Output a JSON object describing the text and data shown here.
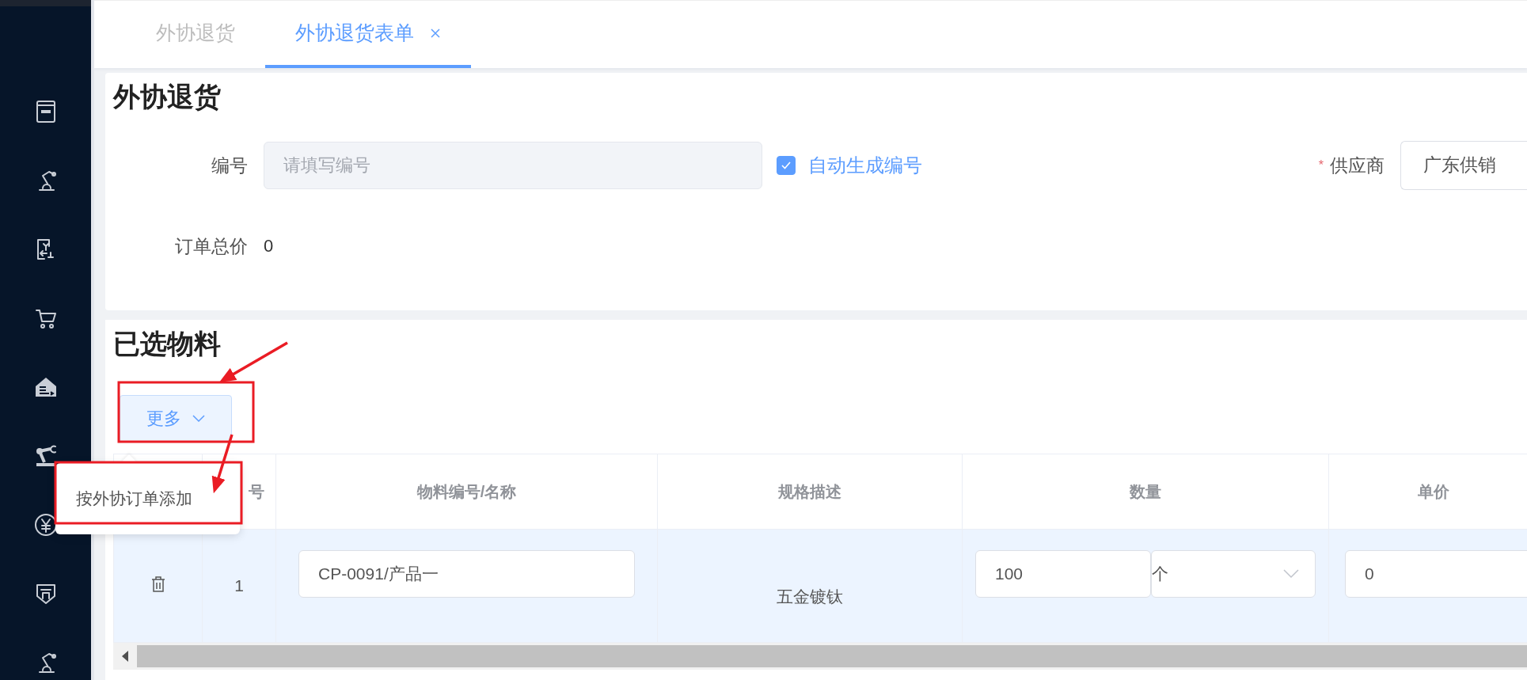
{
  "tabs": [
    {
      "label": "外协退货",
      "selected": false,
      "closable": false
    },
    {
      "label": "外协退货表单",
      "selected": true,
      "closable": true
    }
  ],
  "form": {
    "title": "外协退货",
    "fields": [
      {
        "kind": "input",
        "label": "编号",
        "placeholder": "请填写编号",
        "disabled": true,
        "checkbox": {
          "label": "自动生成编号",
          "checked": true
        }
      },
      {
        "kind": "select",
        "label": "供应商",
        "required_mark": "*",
        "value": "广东供销"
      },
      {
        "kind": "text",
        "label": "订单总价",
        "value": "0"
      }
    ]
  },
  "materials": {
    "title": "已选物料",
    "more_button": "更多",
    "menu": [
      {
        "label": "按外协订单添加"
      }
    ],
    "table": {
      "columns": [
        "",
        "号",
        "物料编号/名称",
        "规格描述",
        "数量",
        "单价"
      ],
      "rows": [
        {
          "selected": true,
          "index": "1",
          "material": "CP-0091/产品一",
          "spec": "五金镀钛",
          "quantity": "100",
          "unit": "个",
          "price": "0"
        }
      ]
    }
  }
}
